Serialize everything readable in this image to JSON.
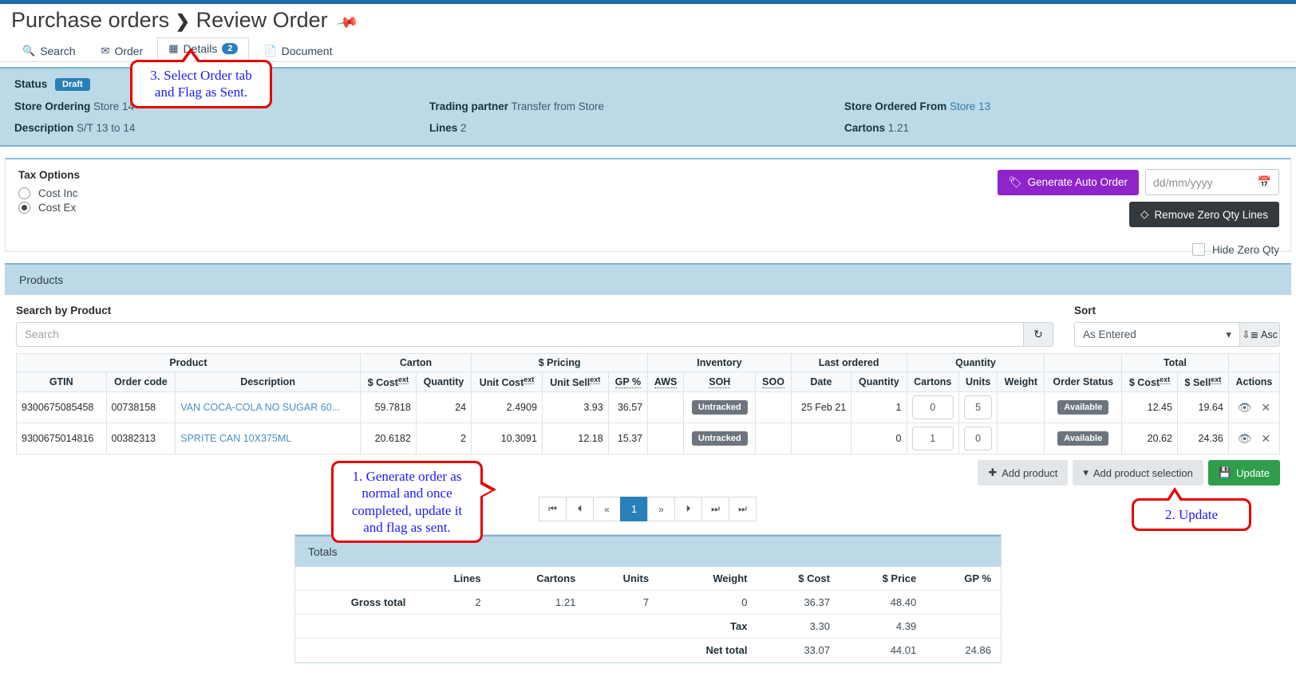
{
  "breadcrumb": {
    "parent": "Purchase orders",
    "separator": "❯",
    "current": "Review Order",
    "pin_icon": "pin-icon"
  },
  "tabs": [
    {
      "label": "Search",
      "icon": "search-icon",
      "active": false,
      "badge": ""
    },
    {
      "label": "Order",
      "icon": "envelope-icon",
      "active": false,
      "badge": ""
    },
    {
      "label": "Details",
      "icon": "grid-icon",
      "active": true,
      "badge": "2"
    },
    {
      "label": "Document",
      "icon": "file-icon",
      "active": false,
      "badge": ""
    }
  ],
  "status_panel": {
    "status_label": "Status",
    "status_value": "Draft",
    "store_ordering_label": "Store Ordering",
    "store_ordering_value": "Store 14",
    "description_label": "Description",
    "description_value": "S/T 13 to 14",
    "trading_partner_label": "Trading partner",
    "trading_partner_value": "Transfer from Store",
    "lines_label": "Lines",
    "lines_value": "2",
    "store_ordered_from_label": "Store Ordered From",
    "store_ordered_from_value": "Store 13",
    "cartons_label": "Cartons",
    "cartons_value": "1.21"
  },
  "tax_options": {
    "title": "Tax Options",
    "option_inc": "Cost Inc",
    "option_ex": "Cost Ex",
    "selected": "Cost Ex",
    "generate_auto_order": "Generate Auto Order",
    "generate_icon": "tag-icon",
    "date_placeholder": "dd/mm/yyyy",
    "date_icon": "calendar-icon",
    "remove_zero_qty_lines": "Remove Zero Qty Lines",
    "remove_icon": "eraser-icon",
    "hide_zero_qty": "Hide Zero Qty",
    "hide_zero_qty_checked": false
  },
  "products": {
    "panel_title": "Products",
    "search_label": "Search by Product",
    "search_placeholder": "Search",
    "search_value": "",
    "refresh_icon": "refresh-icon",
    "sort_label": "Sort",
    "sort_value": "As Entered",
    "sort_direction": "Asc",
    "sort_direction_icon": "sort-asc-icon",
    "group_headers": [
      {
        "label": "Product",
        "span": 3
      },
      {
        "label": "Carton",
        "span": 2
      },
      {
        "label": "$ Pricing",
        "span": 3
      },
      {
        "label": "Inventory",
        "span": 3
      },
      {
        "label": "Last ordered",
        "span": 2
      },
      {
        "label": "Quantity",
        "span": 3
      },
      {
        "label": "",
        "span": 1
      },
      {
        "label": "Total",
        "span": 2
      },
      {
        "label": "",
        "span": 1
      }
    ],
    "columns": [
      {
        "label": "GTIN",
        "sup": "",
        "align": "l"
      },
      {
        "label": "Order code",
        "sup": "",
        "align": "l"
      },
      {
        "label": "Description",
        "sup": "",
        "align": "l"
      },
      {
        "label": "$ Cost",
        "sup": "ext",
        "align": "r"
      },
      {
        "label": "Quantity",
        "sup": "",
        "align": "r"
      },
      {
        "label": "Unit Cost",
        "sup": "ext",
        "align": "r"
      },
      {
        "label": "Unit Sell",
        "sup": "ext",
        "align": "r"
      },
      {
        "label": "GP %",
        "sup": "",
        "align": "r"
      },
      {
        "label": "AWS",
        "sup": "",
        "align": "c"
      },
      {
        "label": "SOH",
        "sup": "",
        "align": "c"
      },
      {
        "label": "SOO",
        "sup": "",
        "align": "c"
      },
      {
        "label": "Date",
        "sup": "",
        "align": "r"
      },
      {
        "label": "Quantity",
        "sup": "",
        "align": "r"
      },
      {
        "label": "Cartons",
        "sup": "",
        "align": "r"
      },
      {
        "label": "Units",
        "sup": "",
        "align": "r"
      },
      {
        "label": "Weight",
        "sup": "",
        "align": "r"
      },
      {
        "label": "Order Status",
        "sup": "",
        "align": "c"
      },
      {
        "label": "$ Cost",
        "sup": "ext",
        "align": "r"
      },
      {
        "label": "$ Sell",
        "sup": "ext",
        "align": "r"
      },
      {
        "label": "Actions",
        "sup": "",
        "align": "c"
      }
    ],
    "rows": [
      {
        "gtin": "9300675085458",
        "order_code": "00738158",
        "description": "VAN COCA-COLA NO SUGAR 60...",
        "cost_ext": "59.7818",
        "carton_quantity": "24",
        "unit_cost_ext": "2.4909",
        "unit_sell_ext": "3.93",
        "gp_pct": "36.57",
        "aws": "",
        "soh": "Untracked",
        "soo": "",
        "last_date": "25 Feb 21",
        "last_quantity": "1",
        "qty_cartons": "0",
        "qty_units": "5",
        "weight": "",
        "order_status": "Available",
        "total_cost_ext": "12.45",
        "total_sell_ext": "19.64",
        "action_view_icon": "eye-icon",
        "action_delete_icon": "close-icon"
      },
      {
        "gtin": "9300675014816",
        "order_code": "00382313",
        "description": "SPRITE CAN 10X375ML",
        "cost_ext": "20.6182",
        "carton_quantity": "2",
        "unit_cost_ext": "10.3091",
        "unit_sell_ext": "12.18",
        "gp_pct": "15.37",
        "aws": "",
        "soh": "Untracked",
        "soo": "",
        "last_date": "",
        "last_quantity": "0",
        "qty_cartons": "1",
        "qty_units": "0",
        "weight": "",
        "order_status": "Available",
        "total_cost_ext": "20.62",
        "total_sell_ext": "24.36",
        "action_view_icon": "eye-icon",
        "action_delete_icon": "close-icon"
      }
    ],
    "action_buttons": [
      {
        "label": "Add product",
        "icon": "plus-icon",
        "style": "grey"
      },
      {
        "label": "Add product selection",
        "icon": "filter-icon",
        "style": "grey"
      },
      {
        "label": "Update",
        "icon": "save-icon",
        "style": "green"
      }
    ],
    "pager": {
      "first": "⏮",
      "prev_page": "⏴",
      "prev": "«",
      "current": "1",
      "next": "»",
      "next_page": "⏵",
      "last": "⏭",
      "very_last": "⏭"
    }
  },
  "totals": {
    "panel_title": "Totals",
    "columns": [
      "",
      "Lines",
      "Cartons",
      "Units",
      "Weight",
      "$ Cost",
      "$ Price",
      "GP %"
    ],
    "rows": [
      {
        "label": "Gross total",
        "lines": "2",
        "cartons": "1.21",
        "units": "7",
        "weight": "0",
        "cost": "36.37",
        "price": "48.40",
        "gp": ""
      },
      {
        "label": "",
        "lines": "",
        "cartons": "",
        "units": "",
        "weight": "Tax",
        "cost": "3.30",
        "price": "4.39",
        "gp": ""
      },
      {
        "label": "",
        "lines": "",
        "cartons": "",
        "units": "",
        "weight": "Net total",
        "cost": "33.07",
        "price": "44.01",
        "gp": "24.86"
      }
    ]
  },
  "callouts": [
    {
      "id": "callout-3",
      "text": "3. Select Order tab and Flag as Sent."
    },
    {
      "id": "callout-1",
      "text": "1. Generate order as normal and once completed, update it and flag as sent."
    },
    {
      "id": "callout-2",
      "text": "2. Update"
    }
  ],
  "colors": {
    "accent_blue": "#2980b9",
    "panel_blue": "#bcd9e8",
    "purple": "#8e24c9",
    "green": "#2e9e4a",
    "callout_border": "#e60000",
    "callout_text": "#1a1aff"
  }
}
